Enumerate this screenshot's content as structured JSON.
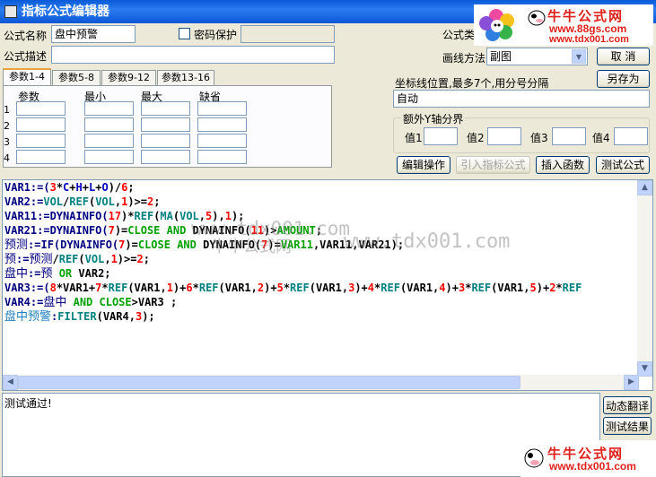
{
  "window": {
    "title": "指标公式编辑器"
  },
  "form": {
    "name_label": "公式名称",
    "name_value": "盘中预警",
    "password_label": "密码保护",
    "desc_label": "公式描述",
    "type_label": "公式类型",
    "draw_label": "画线方法",
    "draw_value": "副图"
  },
  "buttons": {
    "cancel": "取  消",
    "save_as": "另存为",
    "edit_ops": "编辑操作",
    "import_formula": "引入指标公式",
    "insert_func": "插入函数",
    "test_formula": "测试公式",
    "dynamic_translate": "动态翻译",
    "test_result": "测试结果"
  },
  "tabs": [
    "参数1-4",
    "参数5-8",
    "参数9-12",
    "参数13-16"
  ],
  "param_grid": {
    "headers": [
      "参数",
      "最小",
      "最大",
      "缺省"
    ],
    "rows": [
      "1",
      "2",
      "3",
      "4"
    ]
  },
  "coord": {
    "label": "坐标线位置,最多7个,用分号分隔",
    "value": "自动"
  },
  "yaxis": {
    "title": "额外Y轴分界",
    "labels": [
      "值1",
      "值2",
      "值3",
      "值4"
    ]
  },
  "code": [
    [
      [
        "v",
        "VAR1:=("
      ],
      [
        "n",
        "3"
      ],
      [
        "p",
        "*"
      ],
      [
        "f",
        "C"
      ],
      [
        "p",
        "+"
      ],
      [
        "f",
        "H"
      ],
      [
        "p",
        "+"
      ],
      [
        "f",
        "L"
      ],
      [
        "p",
        "+"
      ],
      [
        "f",
        "O"
      ],
      [
        "p",
        ")/"
      ],
      [
        "n",
        "6"
      ],
      [
        "p",
        ";"
      ]
    ],
    [
      [
        "v",
        "VAR2:="
      ],
      [
        "k",
        "VOL"
      ],
      [
        "p",
        "/"
      ],
      [
        "k",
        "REF"
      ],
      [
        "p",
        "("
      ],
      [
        "k",
        "VOL"
      ],
      [
        "p",
        ","
      ],
      [
        "n",
        "1"
      ],
      [
        "p",
        ")>="
      ],
      [
        "n",
        "2"
      ],
      [
        "p",
        ";"
      ]
    ],
    [
      [
        "v",
        "VAR11:=DYNAINFO("
      ],
      [
        "n",
        "17"
      ],
      [
        "p",
        ")*"
      ],
      [
        "k",
        "REF"
      ],
      [
        "p",
        "("
      ],
      [
        "k",
        "MA"
      ],
      [
        "p",
        "("
      ],
      [
        "k",
        "VOL"
      ],
      [
        "p",
        ","
      ],
      [
        "n",
        "5"
      ],
      [
        "p",
        "),"
      ],
      [
        "n",
        "1"
      ],
      [
        "p",
        ");"
      ]
    ],
    [
      [
        "v",
        "VAR21:=DYNAINFO("
      ],
      [
        "n",
        "7"
      ],
      [
        "p",
        ")="
      ],
      [
        "g",
        "CLOSE AND"
      ],
      [
        "p",
        " DYNAINFO("
      ],
      [
        "n",
        "11"
      ],
      [
        "p",
        ")>"
      ],
      [
        "g",
        "AMOUNT"
      ],
      [
        "p",
        ";"
      ]
    ],
    [
      [
        "c",
        "预测"
      ],
      [
        "v",
        ":=IF(DYNAINFO("
      ],
      [
        "n",
        "7"
      ],
      [
        "p",
        ")="
      ],
      [
        "g",
        "CLOSE AND"
      ],
      [
        "p",
        " DYNAINFO("
      ],
      [
        "n",
        "7"
      ],
      [
        "p",
        ")="
      ],
      [
        "g",
        "VAR11"
      ],
      [
        "p",
        ",VAR11,VAR21);"
      ]
    ],
    [
      [
        "c",
        "预"
      ],
      [
        "v",
        ":="
      ],
      [
        "c",
        "预测"
      ],
      [
        "p",
        "/"
      ],
      [
        "k",
        "REF"
      ],
      [
        "p",
        "("
      ],
      [
        "k",
        "VOL"
      ],
      [
        "p",
        ","
      ],
      [
        "n",
        "1"
      ],
      [
        "p",
        ")>="
      ],
      [
        "n",
        "2"
      ],
      [
        "p",
        ";"
      ]
    ],
    [
      [
        "c",
        "盘中"
      ],
      [
        "v",
        ":="
      ],
      [
        "c",
        "预"
      ],
      [
        "g",
        " OR"
      ],
      [
        "p",
        " VAR2;"
      ]
    ],
    [
      [
        "v",
        "VAR3:=("
      ],
      [
        "n",
        "8"
      ],
      [
        "p",
        "*VAR1+"
      ],
      [
        "n",
        "7"
      ],
      [
        "p",
        "*"
      ],
      [
        "k",
        "REF"
      ],
      [
        "p",
        "(VAR1,"
      ],
      [
        "n",
        "1"
      ],
      [
        "p",
        ")+"
      ],
      [
        "n",
        "6"
      ],
      [
        "p",
        "*"
      ],
      [
        "k",
        "REF"
      ],
      [
        "p",
        "(VAR1,"
      ],
      [
        "n",
        "2"
      ],
      [
        "p",
        ")+"
      ],
      [
        "n",
        "5"
      ],
      [
        "p",
        "*"
      ],
      [
        "k",
        "REF"
      ],
      [
        "p",
        "(VAR1,"
      ],
      [
        "n",
        "3"
      ],
      [
        "p",
        ")+"
      ],
      [
        "n",
        "4"
      ],
      [
        "p",
        "*"
      ],
      [
        "k",
        "REF"
      ],
      [
        "p",
        "(VAR1,"
      ],
      [
        "n",
        "4"
      ],
      [
        "p",
        ")+"
      ],
      [
        "n",
        "3"
      ],
      [
        "p",
        "*"
      ],
      [
        "k",
        "REF"
      ],
      [
        "p",
        "(VAR1,"
      ],
      [
        "n",
        "5"
      ],
      [
        "p",
        ")+"
      ],
      [
        "n",
        "2"
      ],
      [
        "p",
        "*"
      ],
      [
        "k",
        "REF"
      ]
    ],
    [
      [
        "v",
        "VAR4:="
      ],
      [
        "c",
        "盘中"
      ],
      [
        "g",
        " AND CLOSE"
      ],
      [
        "p",
        ">VAR3 ;"
      ]
    ],
    [
      [
        "oc",
        "盘中预警"
      ],
      [
        "v",
        ":"
      ],
      [
        "k",
        "FILTER"
      ],
      [
        "p",
        "(VAR4,"
      ],
      [
        "n",
        "3"
      ],
      [
        "p",
        ");"
      ]
    ]
  ],
  "result_text": "测试通过!",
  "watermarks": [
    "www.tdx001.com",
    "牛牛公式网"
  ],
  "logos": {
    "top_name": "牛牛公式网",
    "top_url": "www.88gs.com",
    "top_url2": "www.tdx001.com",
    "bottom_name": "牛牛公式网",
    "bottom_url": "www.tdx001.com"
  }
}
